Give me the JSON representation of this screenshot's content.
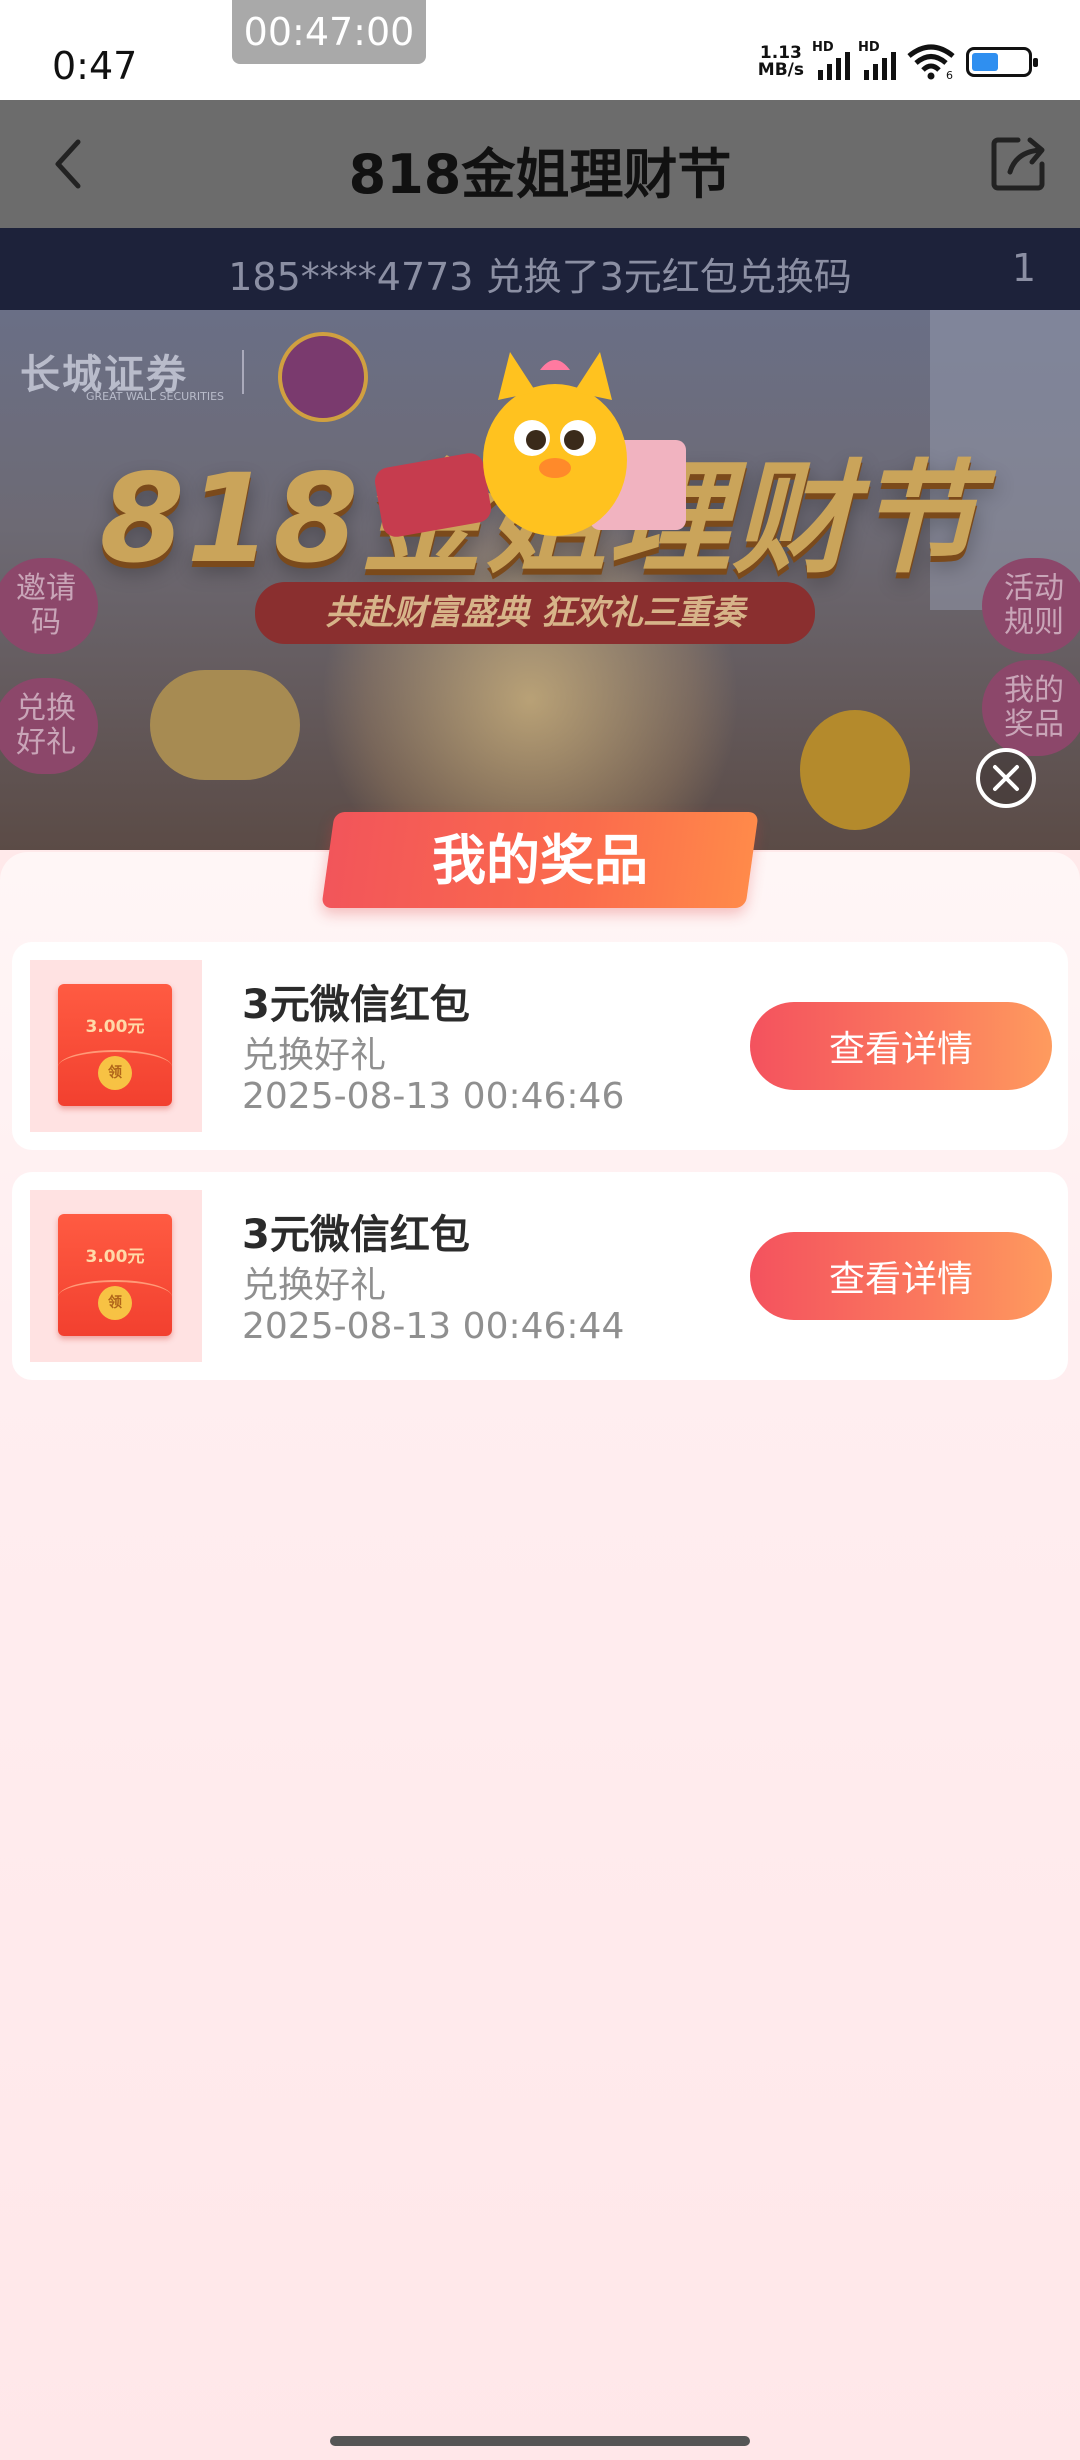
{
  "status_bar": {
    "time": "0:47",
    "recording_timer": "00:47:00",
    "net_speed_value": "1.13",
    "net_speed_unit": "MB/s",
    "signal_1_label": "HD",
    "signal_2_label": "HD",
    "wifi_label": "6",
    "battery_icon": "battery-icon"
  },
  "header": {
    "title": "818金姐理财节"
  },
  "marquee": {
    "text": "185****4773 兑换了3元红包兑换码",
    "counter": "1"
  },
  "banner": {
    "brand": "长城证券",
    "brand_sub": "GREAT WALL SECURITIES",
    "event_title": "818金姐理财节",
    "event_subtitle": "共赴财富盛典  狂欢礼三重奏",
    "side_left": [
      "邀请\n码",
      "兑换\n好礼"
    ],
    "side_right": [
      "活动\n规则",
      "我的\n奖品"
    ]
  },
  "panel": {
    "title": "我的奖品",
    "prizes": [
      {
        "name": "3元微信红包",
        "source": "兑换好礼",
        "time": "2025-08-13 00:46:46",
        "packet_value": "3.00元",
        "packet_coin": "领",
        "button": "查看详情"
      },
      {
        "name": "3元微信红包",
        "source": "兑换好礼",
        "time": "2025-08-13 00:46:44",
        "packet_value": "3.00元",
        "packet_coin": "领",
        "button": "查看详情"
      }
    ]
  },
  "colors": {
    "accent_start": "#f4525e",
    "accent_end": "#fe9b5e",
    "panel_bg": "#ffe9ea"
  }
}
